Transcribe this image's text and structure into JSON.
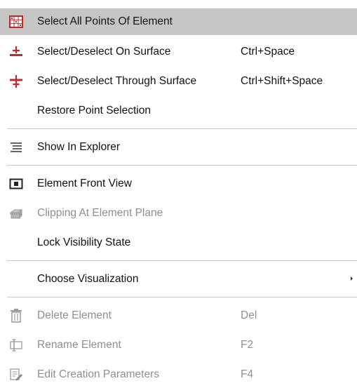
{
  "menu": {
    "items": [
      {
        "label": "Select All Points Of Element",
        "shortcut": "",
        "icon": "grid-points-icon",
        "state": "highlighted"
      },
      {
        "label": "Select/Deselect On Surface",
        "shortcut": "Ctrl+Space",
        "icon": "select-surface-icon",
        "state": "enabled"
      },
      {
        "label": "Select/Deselect Through Surface",
        "shortcut": "Ctrl+Shift+Space",
        "icon": "select-through-icon",
        "state": "enabled"
      },
      {
        "label": "Restore Point Selection",
        "shortcut": "",
        "icon": "",
        "state": "enabled"
      },
      {
        "label": "Show In Explorer",
        "shortcut": "",
        "icon": "list-icon",
        "state": "enabled"
      },
      {
        "label": "Element Front View",
        "shortcut": "",
        "icon": "front-view-icon",
        "state": "enabled"
      },
      {
        "label": "Clipping At Element Plane",
        "shortcut": "",
        "icon": "clipping-icon",
        "state": "disabled"
      },
      {
        "label": "Lock Visibility State",
        "shortcut": "",
        "icon": "",
        "state": "enabled"
      },
      {
        "label": "Choose Visualization",
        "shortcut": "",
        "icon": "",
        "state": "enabled",
        "submenu": true
      },
      {
        "label": "Delete Element",
        "shortcut": "Del",
        "icon": "trash-icon",
        "state": "disabled"
      },
      {
        "label": "Rename Element",
        "shortcut": "F2",
        "icon": "rename-icon",
        "state": "disabled"
      },
      {
        "label": "Edit Creation Parameters",
        "shortcut": "F4",
        "icon": "edit-parameters-icon",
        "state": "disabled"
      }
    ],
    "colors": {
      "highlight": "#c5c5c5",
      "accent_red": "#c0282c",
      "disabled_text": "#8f8f8f"
    }
  }
}
